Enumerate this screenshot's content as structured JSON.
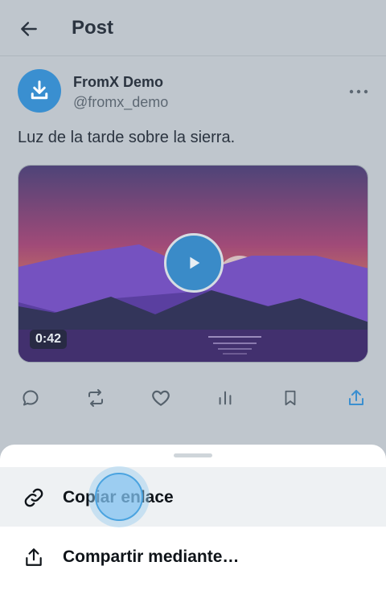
{
  "header": {
    "title": "Post",
    "back_icon": "arrow-left-icon"
  },
  "post": {
    "author_name": "FromX Demo",
    "author_handle": "@fromx_demo",
    "text": "Luz de la tarde sobre la sierra.",
    "video_duration": "0:42"
  },
  "actions": [
    "reply-icon",
    "repost-icon",
    "like-icon",
    "views-icon",
    "bookmark-icon",
    "share-icon"
  ],
  "sheet": {
    "items": [
      {
        "label": "Copiar enlace",
        "icon": "link-icon"
      },
      {
        "label": "Compartir mediante…",
        "icon": "share-icon"
      }
    ]
  },
  "colors": {
    "accent": "#3a8fd0",
    "background": "#bfc6cd",
    "sheet": "#ffffff"
  }
}
